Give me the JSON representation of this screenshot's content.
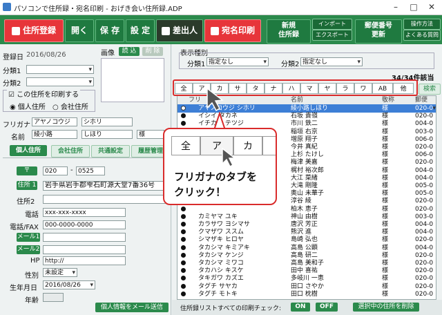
{
  "window": {
    "title": "パソコンで住所録・宛名印刷 - おげき会い住所録.ADP"
  },
  "toolbar": {
    "register": "住所登録",
    "open": "開く",
    "save": "保 存",
    "settings": "設 定",
    "sender": "差出人",
    "address_print": "宛名印刷",
    "new_book_l1": "新規",
    "new_book_l2": "住所録",
    "import": "インポート",
    "export": "エクスポート",
    "postal_l1": "郵便番号",
    "postal_l2": "更新",
    "manual": "操作方法",
    "faq": "よくある質問"
  },
  "left": {
    "reg_date_label": "登録日",
    "reg_date": "2016/08/26",
    "image_label": "画像",
    "image_load": "読 込",
    "image_delete": "削 除",
    "cat1_label": "分類1",
    "cat2_label": "分類2",
    "print_check": "この住所を印刷する",
    "radio_personal": "個人住所",
    "radio_company": "会社住所",
    "furigana_label": "フリガナ",
    "furi_last": "アヤノコウジ",
    "furi_first": "シホリ",
    "name_label": "名前",
    "name_last": "綾小路",
    "name_first": "しほり",
    "honorific": "様",
    "tab_personal": "個人住所",
    "tab_company": "会社住所",
    "tab_common": "共通設定",
    "tab_history": "履歴管理",
    "zip_btn": "〒",
    "zip1": "020",
    "zip2": "0525",
    "addr1_btn": "住所 1",
    "addr1": "岩手県岩手郡雫石町源大堂7番36号",
    "addr2_label": "住所2",
    "tel_label": "電話",
    "tel": "xxx-xxx-xxxx",
    "fax_label": "電話/FAX",
    "fax": "000-0000-0000",
    "mail1_btn": "メール1",
    "mail2_btn": "メール2",
    "hp_label": "HP",
    "hp": "http://",
    "gender_label": "性別",
    "gender": "未設定",
    "birth_label": "生年月日",
    "birth": "2016/08/26",
    "age_label": "年齢",
    "send_mail": "個人情報をメール送信"
  },
  "right": {
    "display_type": "表示種別",
    "cat1_label": "分類1",
    "cat1_value": "指定なし",
    "cat2_label": "分類2",
    "cat2_value": "指定なし",
    "count": "34/34件該当",
    "tabs": [
      "全",
      "ア",
      "カ",
      "サ",
      "タ",
      "ナ",
      "ハ",
      "マ",
      "ヤ",
      "ラ",
      "ワ",
      "AB",
      "他"
    ],
    "search": "検索",
    "col_name": "フリ",
    "col_kanji": "名前",
    "col_title": "敬称",
    "col_zip": "郵便",
    "rows": [
      {
        "kana": "アヤノコウジ シホリ",
        "kanji": "綾小路しほり",
        "title": "様",
        "zip": "020-0"
      },
      {
        "kana": "イシイ タカネ",
        "kanji": "石坂 貴嶺",
        "title": "様",
        "zip": "020-0"
      },
      {
        "kana": "イチカワ テツジ",
        "kanji": "市川 鉄二",
        "title": "様",
        "zip": "004-0"
      },
      {
        "kana": "",
        "kanji": "稲垣 右京",
        "title": "様",
        "zip": "003-0"
      },
      {
        "kana": "",
        "kanji": "増原 翔子",
        "title": "様",
        "zip": "006-0"
      },
      {
        "kana": "",
        "kanji": "今井 真紀",
        "title": "様",
        "zip": "020-0"
      },
      {
        "kana": "",
        "kanji": "上杉 たけし",
        "title": "様",
        "zip": "006-0"
      },
      {
        "kana": "",
        "kanji": "梅津 美嘉",
        "title": "様",
        "zip": "020-0"
      },
      {
        "kana": "",
        "kanji": "梶村 裕次郎",
        "title": "様",
        "zip": "004-0"
      },
      {
        "kana": "",
        "kanji": "大江 菜緒",
        "title": "様",
        "zip": "004-0"
      },
      {
        "kana": "",
        "kanji": "大滝 剛隆",
        "title": "様",
        "zip": "005-0"
      },
      {
        "kana": "",
        "kanji": "奥山 未華子",
        "title": "様",
        "zip": "005-0"
      },
      {
        "kana": "",
        "kanji": "淳谷 綾",
        "title": "様",
        "zip": "020-0"
      },
      {
        "kana": "",
        "kanji": "柏木 恵子",
        "title": "様",
        "zip": "020-0"
      },
      {
        "kana": "カミヤマ ユキ",
        "kanji": "神山 由樹",
        "title": "様",
        "zip": "003-0"
      },
      {
        "kana": "カラサワ ヨシマサ",
        "kanji": "唐沢 芳正",
        "title": "様",
        "zip": "004-0"
      },
      {
        "kana": "クマザワ ススム",
        "kanji": "熊沢 進",
        "title": "様",
        "zip": "004-0"
      },
      {
        "kana": "シマザキ ヒロヤ",
        "kanji": "島崎 弘也",
        "title": "様",
        "zip": "020-0"
      },
      {
        "kana": "タカシマ キミアキ",
        "kanji": "高島 公顕",
        "title": "様",
        "zip": "004-0"
      },
      {
        "kana": "タカシマ ケンジ",
        "kanji": "高島 研二",
        "title": "様",
        "zip": "020-0"
      },
      {
        "kana": "タカシマ ミワコ",
        "kanji": "高島 美和子",
        "title": "様",
        "zip": "020-0"
      },
      {
        "kana": "タカハシ キスケ",
        "kanji": "田中 喜祐",
        "title": "様",
        "zip": "020-0"
      },
      {
        "kana": "タキガワ カズエ",
        "kanji": "多岐川 一恵",
        "title": "様",
        "zip": "020-0"
      },
      {
        "kana": "タグチ サヤカ",
        "kanji": "田口 さやか",
        "title": "様",
        "zip": "020-0"
      },
      {
        "kana": "タグチ モトキ",
        "kanji": "田口 枕樹",
        "title": "様",
        "zip": "020-0"
      }
    ],
    "print_check_label": "住所録リストすべての印刷チェック:",
    "on": "ON",
    "off": "OFF",
    "delete_selected": "選択中の住所を削除"
  },
  "callout": {
    "tab_all": "全",
    "tab_a": "ア",
    "tab_ka": "カ",
    "line1": "フリガナのタブを",
    "line2": "クリック！"
  },
  "colors": {
    "toolbar_green": "#2b8a4c",
    "accent_red": "#e7353a",
    "selection_blue": "#3d7fd6",
    "callout_border": "#d92b2b"
  }
}
